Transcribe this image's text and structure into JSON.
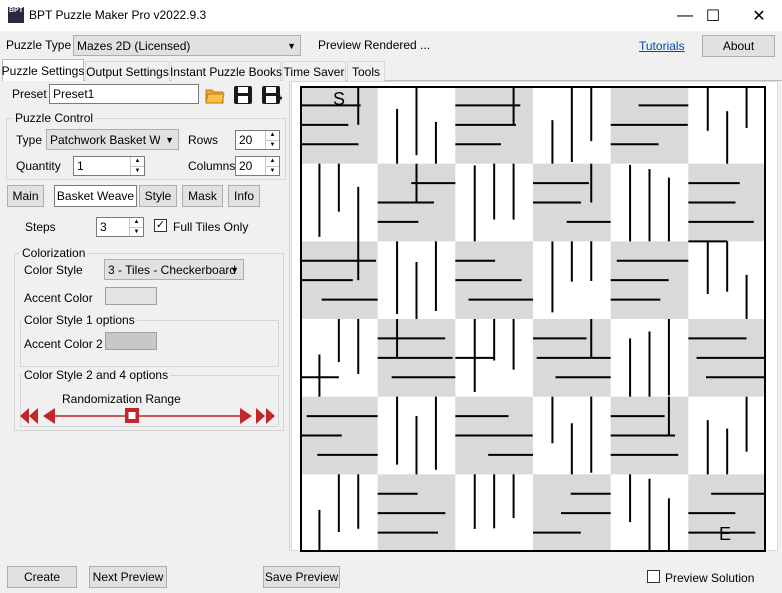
{
  "window": {
    "title": "BPT Puzzle Maker Pro v2022.9.3",
    "icon_text": "BPT",
    "controls": {
      "minimize": "—",
      "maximize": "☐",
      "close": "✕"
    }
  },
  "topbar": {
    "puzzle_type_label": "Puzzle Type",
    "puzzle_type_value": "Mazes 2D (Licensed)",
    "status": "Preview Rendered ...",
    "tutorials_link": "Tutorials",
    "about_button": "About"
  },
  "tabs": [
    "Puzzle Settings",
    "Output Settings",
    "Instant Puzzle Books",
    "Time Saver",
    "Tools"
  ],
  "preset": {
    "label": "Preset",
    "value": "Preset1"
  },
  "puzzle_control": {
    "title": "Puzzle Control",
    "type_label": "Type",
    "type_value": "Patchwork Basket Weave",
    "rows_label": "Rows",
    "rows_value": "20",
    "quantity_label": "Quantity",
    "quantity_value": "1",
    "columns_label": "Columns",
    "columns_value": "20"
  },
  "subtabs": [
    "Main",
    "Basket Weave",
    "Style",
    "Mask",
    "Info"
  ],
  "basket_weave": {
    "steps_label": "Steps",
    "steps_value": "3",
    "full_tiles_label": "Full Tiles Only",
    "full_tiles_checked": true
  },
  "colorization": {
    "title": "Colorization",
    "color_style_label": "Color Style",
    "color_style_value": "3 - Tiles - Checkerboard",
    "accent_color_label": "Accent Color",
    "cs1_title": "Color Style 1 options",
    "accent_color2_label": "Accent Color 2",
    "cs24_title": "Color Style 2 and 4 options",
    "randomization_label": "Randomization Range",
    "randomization_value": 0.5
  },
  "maze": {
    "start_label": "S",
    "end_label": "E",
    "tile_shade": "#d9d9d9",
    "wall_color": "#000000"
  },
  "bottom": {
    "create_button": "Create",
    "next_preview_button": "Next Preview",
    "save_preview_button": "Save Preview",
    "preview_solution_label": "Preview Solution",
    "preview_solution_checked": false
  },
  "colors": {
    "accent_red": "#c0262b",
    "link": "#0645ad"
  }
}
